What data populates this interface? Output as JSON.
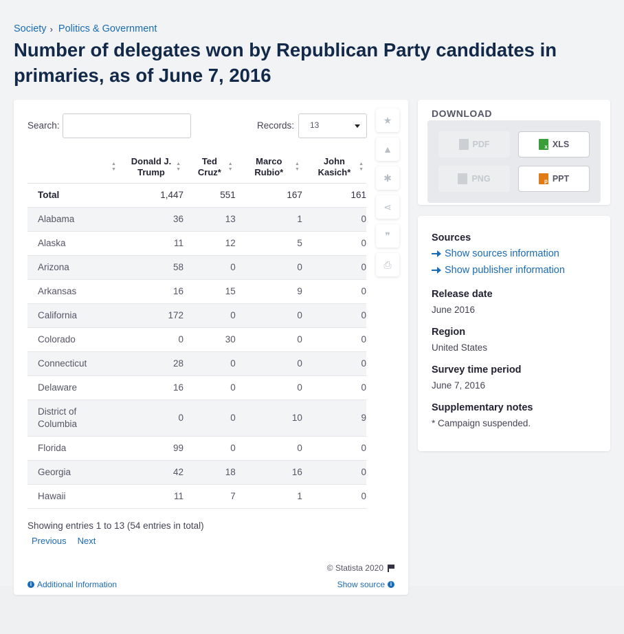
{
  "breadcrumb": {
    "items": [
      "Society",
      "Politics & Government"
    ],
    "separator": "›"
  },
  "page_title": "Number of delegates won by Republican Party candidates in primaries, as of June 7, 2016",
  "controls": {
    "search_label": "Search:",
    "search_value": "",
    "records_label": "Records:",
    "records_value": "13"
  },
  "table": {
    "columns": [
      "",
      "Donald J.\nTrump",
      "Ted\nCruz*",
      "Marco\nRubio*",
      "John\nKasich*"
    ],
    "rows": [
      {
        "name": "Total",
        "values": [
          "1,447",
          "551",
          "167",
          "161"
        ]
      },
      {
        "name": "Alabama",
        "values": [
          "36",
          "13",
          "1",
          "0"
        ]
      },
      {
        "name": "Alaska",
        "values": [
          "11",
          "12",
          "5",
          "0"
        ]
      },
      {
        "name": "Arizona",
        "values": [
          "58",
          "0",
          "0",
          "0"
        ]
      },
      {
        "name": "Arkansas",
        "values": [
          "16",
          "15",
          "9",
          "0"
        ]
      },
      {
        "name": "California",
        "values": [
          "172",
          "0",
          "0",
          "0"
        ]
      },
      {
        "name": "Colorado",
        "values": [
          "0",
          "30",
          "0",
          "0"
        ]
      },
      {
        "name": "Connecticut",
        "values": [
          "28",
          "0",
          "0",
          "0"
        ]
      },
      {
        "name": "Delaware",
        "values": [
          "16",
          "0",
          "0",
          "0"
        ]
      },
      {
        "name": "District of Columbia",
        "values": [
          "0",
          "0",
          "10",
          "9"
        ]
      },
      {
        "name": "Florida",
        "values": [
          "99",
          "0",
          "0",
          "0"
        ]
      },
      {
        "name": "Georgia",
        "values": [
          "42",
          "18",
          "16",
          "0"
        ]
      },
      {
        "name": "Hawaii",
        "values": [
          "11",
          "7",
          "1",
          "0"
        ]
      }
    ]
  },
  "footer": {
    "entries_info": "Showing entries 1 to 13 (54 entries in total)",
    "previous": "Previous",
    "next": "Next",
    "copyright": "© Statista 2020",
    "additional_info": "Additional Information",
    "show_source": "Show source"
  },
  "toolbar": {
    "icons": [
      "star-icon",
      "bell-icon",
      "gear-icon",
      "share-icon",
      "quote-icon",
      "print-icon"
    ]
  },
  "download": {
    "title": "DOWNLOAD",
    "buttons": [
      {
        "label": "PDF",
        "enabled": false
      },
      {
        "label": "XLS",
        "enabled": true
      },
      {
        "label": "PNG",
        "enabled": false
      },
      {
        "label": "PPT",
        "enabled": true
      }
    ]
  },
  "info": {
    "sources_heading": "Sources",
    "show_sources": "Show sources information",
    "show_publisher": "Show publisher information",
    "release_heading": "Release date",
    "release_value": "June 2016",
    "region_heading": "Region",
    "region_value": "United States",
    "survey_heading": "Survey time period",
    "survey_value": "June 7, 2016",
    "notes_heading": "Supplementary notes",
    "notes_value": "* Campaign suspended."
  },
  "colors": {
    "link": "#1a6bb5",
    "title": "#12294a",
    "xls": "#3a9d3a",
    "ppt": "#e07c18"
  }
}
